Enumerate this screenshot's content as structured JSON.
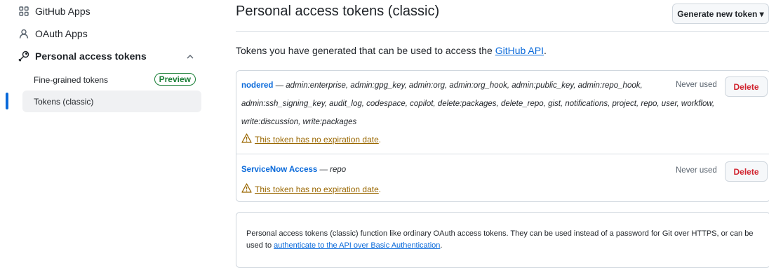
{
  "sidebar": {
    "items": [
      {
        "label": "GitHub Apps",
        "icon": "apps-grid-icon"
      },
      {
        "label": "OAuth Apps",
        "icon": "person-icon"
      },
      {
        "label": "Personal access tokens",
        "icon": "key-icon"
      }
    ],
    "sub_items": [
      {
        "label": "Fine-grained tokens",
        "badge": "Preview"
      },
      {
        "label": "Tokens (classic)"
      }
    ]
  },
  "header": {
    "title": "Personal access tokens (classic)",
    "generate_label": "Generate new token ▾"
  },
  "intro": {
    "text": "Tokens you have generated that can be used to access the ",
    "link": "GitHub API",
    "end": "."
  },
  "tokens": [
    {
      "name": "nodered",
      "scopes": "— admin:enterprise, admin:gpg_key, admin:org, admin:org_hook, admin:public_key, admin:repo_hook, admin:ssh_signing_key, audit_log, codespace, copilot, delete:packages, delete_repo, gist, notifications, project, repo, user, workflow, write:discussion, write:packages",
      "status": "Never used",
      "delete_label": "Delete",
      "warning": "This token has no expiration date",
      "warning_end": "."
    },
    {
      "name": "ServiceNow Access",
      "scopes": "— repo",
      "status": "Never used",
      "delete_label": "Delete",
      "warning": "This token has no expiration date",
      "warning_end": "."
    }
  ],
  "info": {
    "text": "Personal access tokens (classic) function like ordinary OAuth access tokens. They can be used instead of a password for Git over HTTPS, or can be used to ",
    "link": "authenticate to the API over Basic Authentication",
    "end": "."
  },
  "colors": {
    "link": "#0969da",
    "danger": "#d1242f",
    "warning": "#9a6700",
    "success": "#1a7f37"
  }
}
